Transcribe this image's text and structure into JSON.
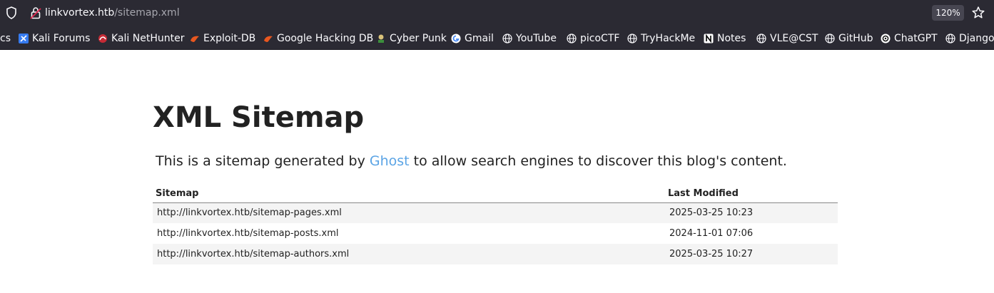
{
  "browser": {
    "url_host": "linkvortex.htb",
    "url_path": "/sitemap.xml",
    "zoom": "120%"
  },
  "bookmarks": [
    {
      "label": "cs",
      "icon": "none"
    },
    {
      "label": "Kali Forums",
      "icon": "kali-forums-icon"
    },
    {
      "label": "Kali NetHunter",
      "icon": "nethunter-icon"
    },
    {
      "label": "Exploit-DB",
      "icon": "exploitdb-icon"
    },
    {
      "label": "Google Hacking DB",
      "icon": "ghdb-icon"
    },
    {
      "label": "Cyber Punk",
      "icon": "cyberpunk-icon"
    },
    {
      "label": "Gmail",
      "icon": "google-icon"
    },
    {
      "label": "YouTube",
      "icon": "globe-icon"
    },
    {
      "label": "picoCTF",
      "icon": "globe-icon"
    },
    {
      "label": "TryHackMe",
      "icon": "globe-icon"
    },
    {
      "label": "Notes",
      "icon": "notion-icon"
    },
    {
      "label": "VLE@CST",
      "icon": "globe-icon"
    },
    {
      "label": "GitHub",
      "icon": "globe-icon"
    },
    {
      "label": "ChatGPT",
      "icon": "chatgpt-icon"
    },
    {
      "label": "Django",
      "icon": "globe-icon"
    }
  ],
  "page": {
    "title": "XML Sitemap",
    "intro_before": "This is a sitemap generated by ",
    "intro_link": "Ghost",
    "intro_after": " to allow search engines to discover this blog's content.",
    "link_color": "#5ba4e5"
  },
  "table": {
    "headers": [
      "Sitemap",
      "Last Modified"
    ],
    "rows": [
      {
        "url": "http://linkvortex.htb/sitemap-pages.xml",
        "modified": "2025-03-25 10:23"
      },
      {
        "url": "http://linkvortex.htb/sitemap-posts.xml",
        "modified": "2024-11-01 07:06"
      },
      {
        "url": "http://linkvortex.htb/sitemap-authors.xml",
        "modified": "2025-03-25 10:27"
      }
    ]
  }
}
